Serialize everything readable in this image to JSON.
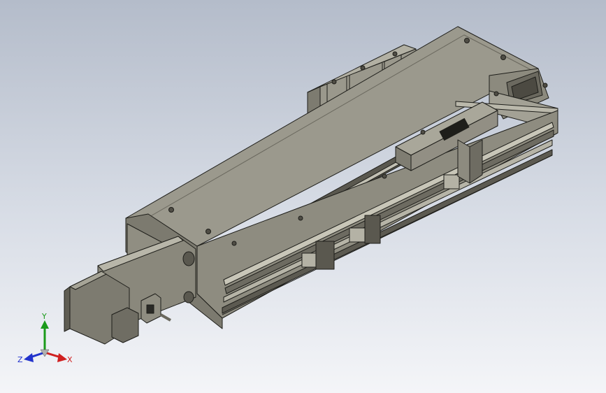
{
  "viewport": {
    "background_top": "#b4bcca",
    "background_bottom": "#f4f5f8"
  },
  "model": {
    "component": "linear-actuator-module",
    "body_color": "#8e8c80",
    "body_light": "#a8a698",
    "body_dark": "#5f5d53",
    "edge_color": "#1e1e1a",
    "motor_color": "#8a887c"
  },
  "triad": {
    "x_label": "X",
    "y_label": "Y",
    "z_label": "Z",
    "x_color": "#d02020",
    "y_color": "#1a9a1a",
    "z_color": "#2233cc"
  }
}
